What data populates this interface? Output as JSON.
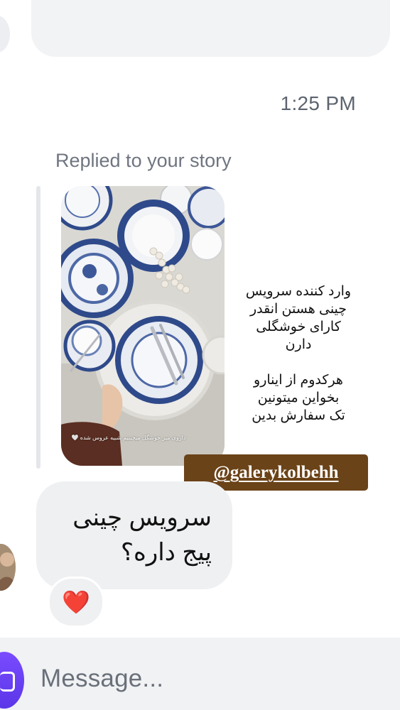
{
  "thread": {
    "timestamp": "1:25 PM",
    "reply_context": "Replied to your story"
  },
  "story": {
    "image_caption": "داروی میز خوشگل میچینیم شبیه عروس شده 🤍",
    "text_lines": [
      "وارد کننده سرویس",
      "چینی هستن انقدر",
      "کارای خوشگلی",
      "دارن",
      "",
      "هرکدوم از اینارو",
      "بخواین میتونین",
      "تک سفارش بدین"
    ],
    "mention": "@galerykolbehh",
    "mention_color": "#6b4318"
  },
  "message": {
    "lines": [
      "سرویس چینی",
      "پیج داره؟"
    ],
    "reaction": "❤️",
    "reaction_icon": "heart-icon"
  },
  "composer": {
    "placeholder": "Message...",
    "camera_icon": "camera-icon",
    "accent_color": "#6b3bff"
  }
}
